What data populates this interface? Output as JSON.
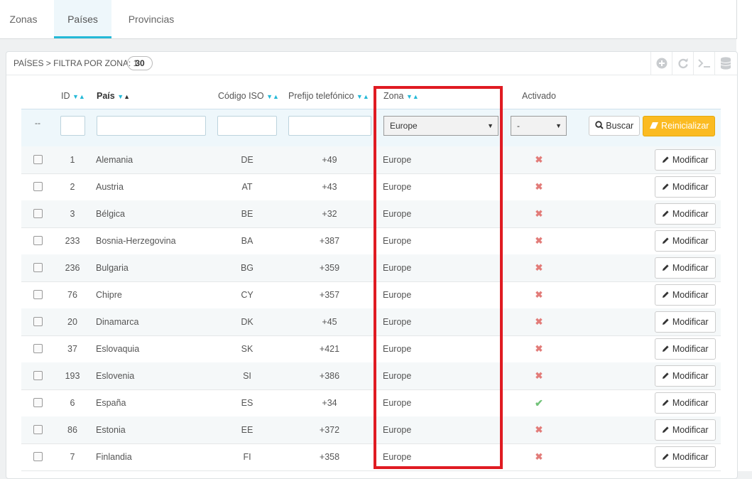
{
  "tabs": [
    {
      "label": "Zonas",
      "active": false
    },
    {
      "label": "Países",
      "active": true
    },
    {
      "label": "Provincias",
      "active": false
    }
  ],
  "panel": {
    "title": "PAÍSES > FILTRA POR ZONA: 1",
    "count": "30",
    "toolbar_icons": [
      "add-icon",
      "refresh-icon",
      "terminal-icon",
      "database-icon"
    ]
  },
  "columns": {
    "id": "ID",
    "country": "País",
    "iso": "Código ISO",
    "phone": "Prefijo telefónico",
    "zone": "Zona",
    "active": "Activado"
  },
  "filters": {
    "bulk": "--",
    "zone_selected": "Europe",
    "active_selected": "-",
    "search_label": "Buscar",
    "reset_label": "Reinicializar"
  },
  "edit_label": "Modificar",
  "rows": [
    {
      "id": "1",
      "country": "Alemania",
      "iso": "DE",
      "phone": "+49",
      "zone": "Europe",
      "active": false
    },
    {
      "id": "2",
      "country": "Austria",
      "iso": "AT",
      "phone": "+43",
      "zone": "Europe",
      "active": false
    },
    {
      "id": "3",
      "country": "Bélgica",
      "iso": "BE",
      "phone": "+32",
      "zone": "Europe",
      "active": false
    },
    {
      "id": "233",
      "country": "Bosnia-Herzegovina",
      "iso": "BA",
      "phone": "+387",
      "zone": "Europe",
      "active": false
    },
    {
      "id": "236",
      "country": "Bulgaria",
      "iso": "BG",
      "phone": "+359",
      "zone": "Europe",
      "active": false
    },
    {
      "id": "76",
      "country": "Chipre",
      "iso": "CY",
      "phone": "+357",
      "zone": "Europe",
      "active": false
    },
    {
      "id": "20",
      "country": "Dinamarca",
      "iso": "DK",
      "phone": "+45",
      "zone": "Europe",
      "active": false
    },
    {
      "id": "37",
      "country": "Eslovaquia",
      "iso": "SK",
      "phone": "+421",
      "zone": "Europe",
      "active": false
    },
    {
      "id": "193",
      "country": "Eslovenia",
      "iso": "SI",
      "phone": "+386",
      "zone": "Europe",
      "active": false
    },
    {
      "id": "6",
      "country": "España",
      "iso": "ES",
      "phone": "+34",
      "zone": "Europe",
      "active": true
    },
    {
      "id": "86",
      "country": "Estonia",
      "iso": "EE",
      "phone": "+372",
      "zone": "Europe",
      "active": false
    },
    {
      "id": "7",
      "country": "Finlandia",
      "iso": "FI",
      "phone": "+358",
      "zone": "Europe",
      "active": false
    }
  ],
  "colors": {
    "accent": "#25b9d7",
    "reset_button": "#fbbb22",
    "highlight_box": "#e01b22",
    "disabled_x": "#e27c79",
    "enabled_check": "#72c279"
  }
}
